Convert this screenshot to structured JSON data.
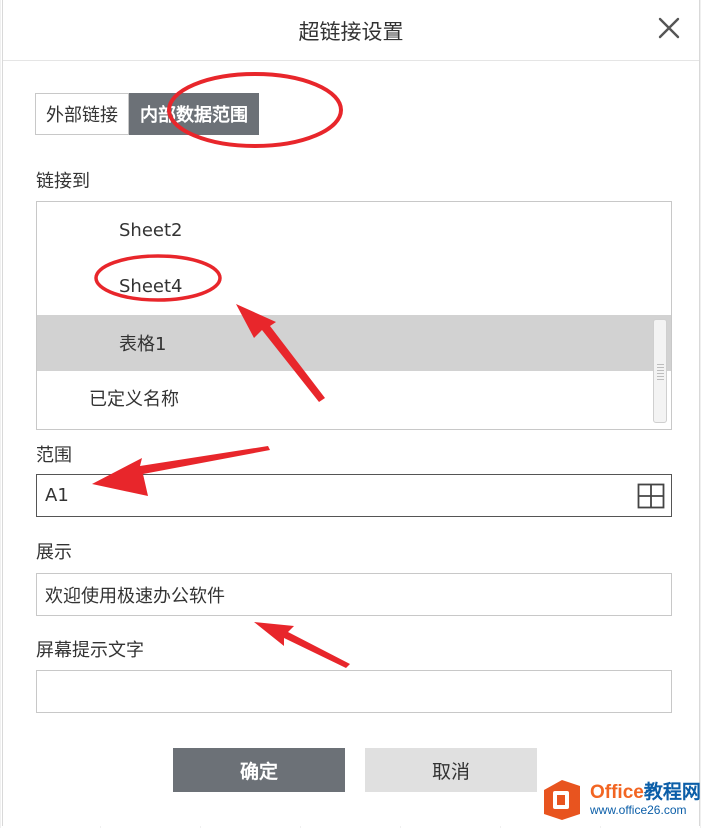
{
  "dialog": {
    "title": "超链接设置",
    "close_icon": "close-icon"
  },
  "tabs": [
    {
      "label": "外部链接",
      "active": false
    },
    {
      "label": "内部数据范围",
      "active": true
    }
  ],
  "link_to": {
    "label": "链接到",
    "items": [
      {
        "label": "Sheet2",
        "selected": false
      },
      {
        "label": "Sheet4",
        "selected": false
      },
      {
        "label": "表格1",
        "selected": true
      },
      {
        "label": "已定义名称",
        "selected": false
      }
    ]
  },
  "range": {
    "label": "范围",
    "value": "A1",
    "icon": "range-select-icon"
  },
  "display": {
    "label": "展示",
    "value": "欢迎使用极速办公软件"
  },
  "tooltip": {
    "label": "屏幕提示文字",
    "value": ""
  },
  "buttons": {
    "ok": "确定",
    "cancel": "取消"
  },
  "watermark": {
    "title_main": "Office",
    "title_rest": "教程网",
    "url": "www.office26.com"
  },
  "colors": {
    "active_tab": "#6c7177",
    "annotation": "#e8262b",
    "selected_row": "#d2d2d2"
  }
}
